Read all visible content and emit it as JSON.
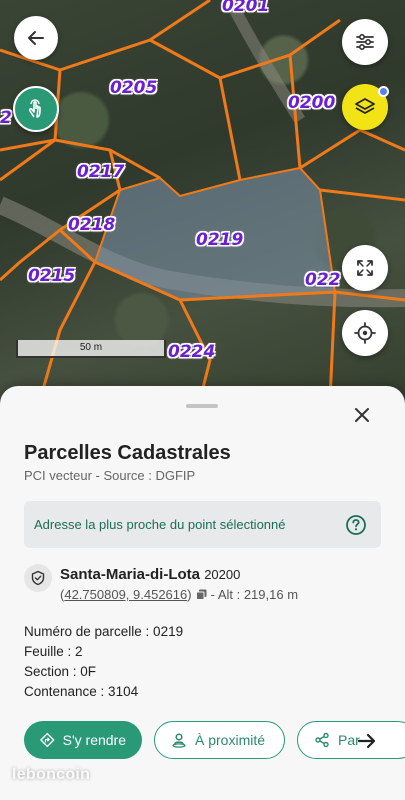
{
  "map": {
    "parcel_labels": [
      "0201",
      "0205",
      "0200",
      "0217",
      "0218",
      "0219",
      "0215",
      "022",
      "0224",
      "2"
    ],
    "scale_label": "50 m",
    "colors": {
      "parcel_line": "#f07a1a",
      "parcel_label": "#6b1fd1",
      "selected_fill": "#7d93ad"
    },
    "icons": [
      "back-arrow-icon",
      "touch-hand-icon",
      "settings-sliders-icon",
      "layers-icon",
      "fullscreen-icon",
      "locate-crosshair-icon"
    ]
  },
  "sheet": {
    "title": "Parcelles Cadastrales",
    "subtitle": "PCI vecteur - Source : DGFIP",
    "address_prompt": "Adresse la plus proche du point sélectionné",
    "location": {
      "city": "Santa-Maria-di-Lota",
      "zip": "20200",
      "coords": "42.750809, 9.452616",
      "altitude": "- Alt : 219,16 m"
    },
    "info": {
      "parcel_number": "Numéro de parcelle : 0219",
      "feuille": "Feuille : 2",
      "section": "Section : 0F",
      "contenance": "Contenance : 3104"
    },
    "actions": {
      "go": "S'y rendre",
      "nearby": "À proximité",
      "share": "Par"
    },
    "accent_color": "#2a9a76"
  },
  "watermark": "leboncoin"
}
